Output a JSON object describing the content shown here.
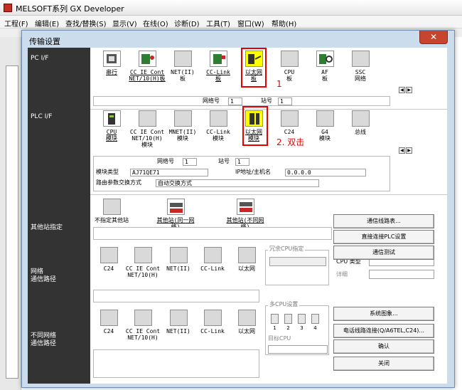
{
  "app": {
    "title": "MELSOFT系列 GX Developer",
    "menu": [
      "工程(F)",
      "编辑(E)",
      "查找/替换(S)",
      "显示(V)",
      "在线(O)",
      "诊断(D)",
      "工具(T)",
      "窗口(W)",
      "帮助(H)"
    ]
  },
  "dialog": {
    "title": "传输设置",
    "close": "✕",
    "sections": {
      "pc_if": "PC I/F",
      "plc_if": "PLC I/F",
      "other_station": "其他站指定",
      "network_route": "网络\n通信路径",
      "diff_network_route": "不同网络\n通信路径"
    },
    "pc_if_items": [
      "串行",
      "CC IE Cont\nNET/10(H)板",
      "NET(II)\n板",
      "CC-Link\n板",
      "以太网\n板",
      "CPU\n板",
      "AF\n板",
      "SSC\n网络"
    ],
    "pc_if_fields": {
      "network_no_label": "网络号",
      "network_no": "1",
      "station_no_label": "站号",
      "station_no": "1"
    },
    "plc_if_items": [
      "CPU\n模块",
      "CC IE Cont\nNET/10(H)\n模块",
      "MNET(II)\n模块",
      "CC-Link\n模块",
      "以太网\n模块",
      "C24",
      "G4\n模块",
      "总线"
    ],
    "plc_if_fields": {
      "network_no_label": "网络号",
      "network_no": "1",
      "station_no_label": "站号",
      "station_no": "1",
      "module_type_label": "模块类型",
      "module_type": "AJ71QE71",
      "ip_label": "IP地址/主机名",
      "ip": "0.0.0.0",
      "route_label": "路由参数交换方式",
      "route": "自动交换方式"
    },
    "other_items": [
      "不指定其他站",
      "其他站(同一网络)",
      "其他站(不同网络)"
    ],
    "network_items": [
      "C24",
      "CC IE Cont\nNET/10(H)",
      "NET(II)",
      "CC-Link",
      "以太网"
    ],
    "diff_network_items": [
      "C24",
      "CC IE Cont\nNET/10(H)",
      "NET(II)",
      "CC-Link",
      "以太网"
    ],
    "redundant_cpu": {
      "label": "冗余CPU指定"
    },
    "multi_cpu": {
      "label": "多CPU设置",
      "numbers": [
        "1",
        "2",
        "3",
        "4"
      ],
      "target_label": "目标CPU"
    },
    "cpu_type": {
      "label": "CPU 类型",
      "detail_label": "详细"
    },
    "buttons": {
      "comm_route_table": "通信线路表...",
      "direct_plc": "直接连接PLC设置",
      "comm_test": "通信测试",
      "system_image": "系统图象...",
      "phone_line": "电话线路连接(Q/A6TEL,C24)...",
      "ok": "确认",
      "close": "关闭"
    },
    "annotations": {
      "step1": "1",
      "step2": "2. 双击"
    }
  },
  "colors": {
    "dialog_bg": "#cbdcec",
    "left_panel": "#333333",
    "highlight": "#ffff00",
    "annotation": "#e60000",
    "close_btn": "#c7452f"
  }
}
